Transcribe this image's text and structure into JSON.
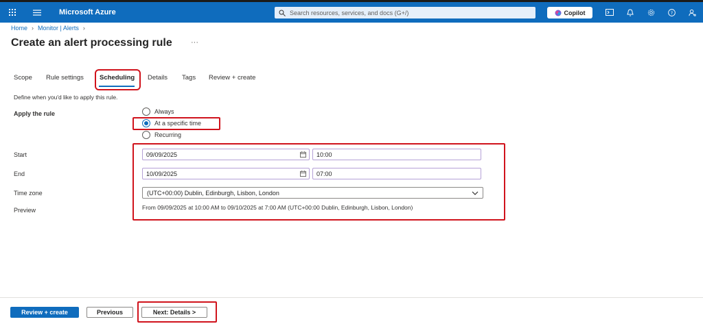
{
  "topbar": {
    "brand": "Microsoft Azure",
    "search_placeholder": "Search resources, services, and docs (G+/)",
    "copilot_label": "Copilot"
  },
  "breadcrumb": [
    "Home",
    "Monitor | Alerts"
  ],
  "page": {
    "title": "Create an alert processing rule",
    "more": "···"
  },
  "tabs": [
    "Scope",
    "Rule settings",
    "Scheduling",
    "Details",
    "Tags",
    "Review + create"
  ],
  "active_tab": "Scheduling",
  "scheduling": {
    "description": "Define when you'd like to apply this rule.",
    "apply_label": "Apply the rule",
    "options": [
      "Always",
      "At a specific time",
      "Recurring"
    ],
    "selected_option": "At a specific time",
    "start_label": "Start",
    "start_date": "09/09/2025",
    "start_time": "10:00",
    "end_label": "End",
    "end_date": "10/09/2025",
    "end_time": "07:00",
    "timezone_label": "Time zone",
    "timezone_value": "(UTC+00:00) Dublin, Edinburgh, Lisbon, London",
    "preview_label": "Preview",
    "preview_text": "From 09/09/2025 at 10:00 AM to 09/10/2025 at 7:00 AM (UTC+00:00 Dublin, Edinburgh, Lisbon, London)"
  },
  "footer": {
    "review_create": "Review + create",
    "previous": "Previous",
    "next": "Next: Details >"
  },
  "colors": {
    "brand_blue": "#0f6cbd",
    "highlight_red": "#d0121b"
  }
}
